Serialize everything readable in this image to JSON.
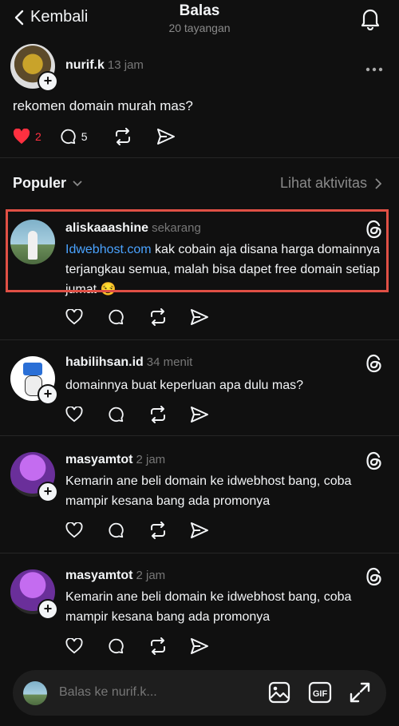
{
  "header": {
    "back_label": "Kembali",
    "title": "Balas",
    "subtitle": "20 tayangan"
  },
  "original_post": {
    "username": "nurif.k",
    "time": "13 jam",
    "text": "rekomen domain murah mas?",
    "likes": "2",
    "comments": "5"
  },
  "sort": {
    "label": "Populer",
    "activity_label": "Lihat aktivitas"
  },
  "replies": [
    {
      "username": "aliskaaashine",
      "time": "sekarang",
      "link": "Idwebhost.com",
      "text": " kak cobain aja disana harga domainnya terjangkau semua, malah bisa dapet free domain setiap jumat 😏"
    },
    {
      "username": "habilihsan.id",
      "time": "34 menit",
      "text": "domainnya buat keperluan apa dulu mas?"
    },
    {
      "username": "masyamtot",
      "time": "2 jam",
      "text": "Kemarin ane beli domain ke idwebhost bang, coba mampir kesana bang ada promonya"
    },
    {
      "username": "masyamtot",
      "time": "2 jam",
      "text": "Kemarin ane beli domain ke idwebhost bang, coba mampir kesana bang ada promonya"
    }
  ],
  "composer": {
    "placeholder": "Balas ke nurif.k..."
  },
  "colors": {
    "background": "#101010",
    "link": "#4aa3ff",
    "like": "#ff3040",
    "highlight": "#e05045"
  }
}
